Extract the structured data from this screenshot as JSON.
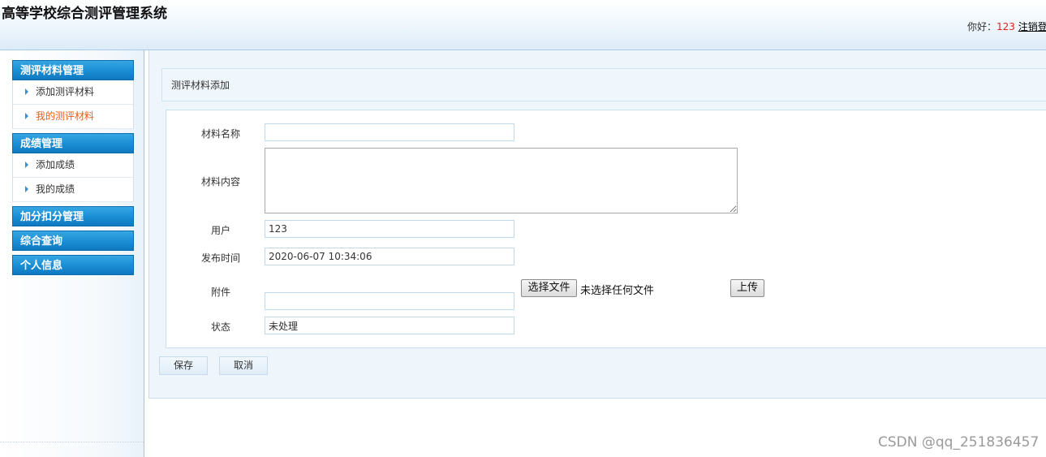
{
  "header": {
    "app_title": "高等学校综合测评管理系统",
    "greeting": "你好：",
    "user_name": "123",
    "logout": "注销登"
  },
  "sidebar": {
    "groups": [
      {
        "title": "测评材料管理",
        "items": [
          {
            "label": "添加测评材料"
          },
          {
            "label": "我的测评材料",
            "active": true
          }
        ]
      },
      {
        "title": "成绩管理",
        "items": [
          {
            "label": "添加成绩"
          },
          {
            "label": "我的成绩"
          }
        ]
      },
      {
        "title": "加分扣分管理",
        "items": []
      },
      {
        "title": "综合查询",
        "items": []
      },
      {
        "title": "个人信息",
        "items": []
      }
    ]
  },
  "main": {
    "section_title": "测评材料添加",
    "form": {
      "material_name": {
        "label": "材料名称",
        "value": ""
      },
      "material_content": {
        "label": "材料内容",
        "value": ""
      },
      "user": {
        "label": "用户",
        "value": "123"
      },
      "publish_time": {
        "label": "发布时间",
        "value": "2020-06-07 10:34:06"
      },
      "attachment": {
        "label": "附件",
        "value": "",
        "choose_file_button": "选择文件",
        "no_file_text": "未选择任何文件",
        "upload_button": "上传"
      },
      "status": {
        "label": "状态",
        "value": "未处理"
      }
    },
    "actions": {
      "save": "保存",
      "cancel": "取消"
    }
  },
  "watermark": "CSDN @qq_251836457",
  "colors": {
    "menu_header": "#1a8dd3",
    "active_menu_item": "#f05a14",
    "user_name": "#e02020"
  }
}
